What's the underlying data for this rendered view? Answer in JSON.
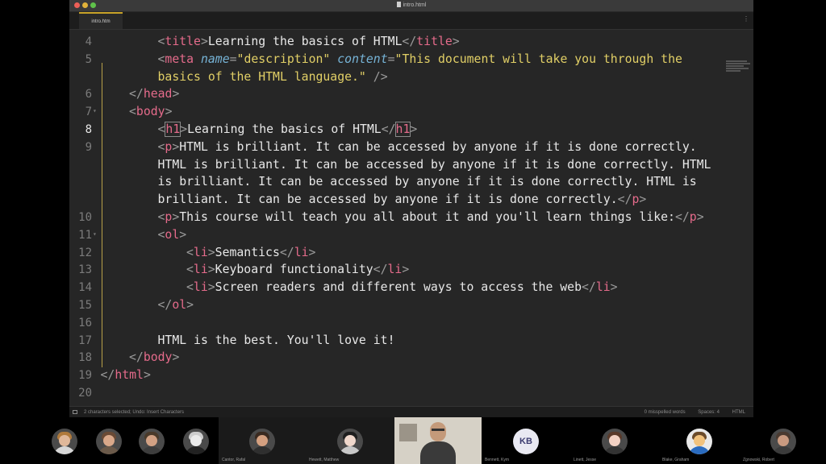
{
  "window": {
    "title": "intro.html",
    "tab_label": "intro.htm",
    "tab_menu_icon": "more-vertical-icon"
  },
  "editor": {
    "lines": [
      {
        "n": "4",
        "indent": 2,
        "parts": [
          [
            "punct",
            "<"
          ],
          [
            "tag",
            "title"
          ],
          [
            "punct",
            ">"
          ],
          [
            "txt",
            "Learning the basics of HTML"
          ],
          [
            "punct",
            "</"
          ],
          [
            "tag",
            "title"
          ],
          [
            "punct",
            ">"
          ]
        ]
      },
      {
        "n": "5",
        "indent": 2,
        "parts": [
          [
            "punct",
            "<"
          ],
          [
            "tag",
            "meta "
          ],
          [
            "attr",
            "name"
          ],
          [
            "punct",
            "="
          ],
          [
            "str",
            "\"description\""
          ],
          [
            "txt",
            " "
          ],
          [
            "attr",
            "content"
          ],
          [
            "punct",
            "="
          ],
          [
            "str",
            "\"This document will take you through the"
          ]
        ]
      },
      {
        "n": "",
        "indent": 2,
        "parts": [
          [
            "str",
            "basics of the HTML language.\""
          ],
          [
            "txt",
            " "
          ],
          [
            "punct",
            "/>"
          ]
        ]
      },
      {
        "n": "6",
        "indent": 1,
        "parts": [
          [
            "punct",
            "</"
          ],
          [
            "tag",
            "head"
          ],
          [
            "punct",
            ">"
          ]
        ]
      },
      {
        "n": "7",
        "indent": 1,
        "fold": true,
        "parts": [
          [
            "punct",
            "<"
          ],
          [
            "tag",
            "body"
          ],
          [
            "punct",
            ">"
          ]
        ]
      },
      {
        "n": "8",
        "indent": 2,
        "active": true,
        "parts": [
          [
            "punct",
            "<"
          ],
          [
            "cursor",
            ""
          ],
          [
            "tag",
            "h1"
          ],
          [
            "punct",
            ">"
          ],
          [
            "txt",
            "Learning the basics of HTML"
          ],
          [
            "punct",
            "</"
          ],
          [
            "tag",
            "h1"
          ],
          [
            "punct",
            ">"
          ]
        ]
      },
      {
        "n": "9",
        "indent": 2,
        "parts": [
          [
            "punct",
            "<"
          ],
          [
            "tag",
            "p"
          ],
          [
            "punct",
            ">"
          ],
          [
            "txt",
            "HTML is brilliant. It can be accessed by anyone if it is done correctly."
          ]
        ]
      },
      {
        "n": "",
        "indent": 2,
        "parts": [
          [
            "txt",
            "HTML is brilliant. It can be accessed by anyone if it is done correctly. HTML"
          ]
        ]
      },
      {
        "n": "",
        "indent": 2,
        "parts": [
          [
            "txt",
            "is brilliant. It can be accessed by anyone if it is done correctly. HTML is"
          ]
        ]
      },
      {
        "n": "",
        "indent": 2,
        "parts": [
          [
            "txt",
            "brilliant. It can be accessed by anyone if it is done correctly."
          ],
          [
            "punct",
            "</"
          ],
          [
            "tag",
            "p"
          ],
          [
            "punct",
            ">"
          ]
        ]
      },
      {
        "n": "10",
        "indent": 2,
        "parts": [
          [
            "punct",
            "<"
          ],
          [
            "tag",
            "p"
          ],
          [
            "punct",
            ">"
          ],
          [
            "txt",
            "This course will teach you all about it and you'll learn things like:"
          ],
          [
            "punct",
            "</"
          ],
          [
            "tag",
            "p"
          ],
          [
            "punct",
            ">"
          ]
        ]
      },
      {
        "n": "11",
        "indent": 2,
        "fold": true,
        "parts": [
          [
            "punct",
            "<"
          ],
          [
            "tag",
            "ol"
          ],
          [
            "punct",
            ">"
          ]
        ]
      },
      {
        "n": "12",
        "indent": 3,
        "parts": [
          [
            "punct",
            "<"
          ],
          [
            "tag",
            "li"
          ],
          [
            "punct",
            ">"
          ],
          [
            "txt",
            "Semantics"
          ],
          [
            "punct",
            "</"
          ],
          [
            "tag",
            "li"
          ],
          [
            "punct",
            ">"
          ]
        ]
      },
      {
        "n": "13",
        "indent": 3,
        "parts": [
          [
            "punct",
            "<"
          ],
          [
            "tag",
            "li"
          ],
          [
            "punct",
            ">"
          ],
          [
            "txt",
            "Keyboard functionality"
          ],
          [
            "punct",
            "</"
          ],
          [
            "tag",
            "li"
          ],
          [
            "punct",
            ">"
          ]
        ]
      },
      {
        "n": "14",
        "indent": 3,
        "parts": [
          [
            "punct",
            "<"
          ],
          [
            "tag",
            "li"
          ],
          [
            "punct",
            ">"
          ],
          [
            "txt",
            "Screen readers and different ways to access the web"
          ],
          [
            "punct",
            "</"
          ],
          [
            "tag",
            "li"
          ],
          [
            "punct",
            ">"
          ]
        ]
      },
      {
        "n": "15",
        "indent": 2,
        "parts": [
          [
            "punct",
            "</"
          ],
          [
            "tag",
            "ol"
          ],
          [
            "punct",
            ">"
          ]
        ]
      },
      {
        "n": "16",
        "indent": 2,
        "parts": []
      },
      {
        "n": "17",
        "indent": 2,
        "parts": [
          [
            "txt",
            "HTML is the best. You'll love it!"
          ]
        ]
      },
      {
        "n": "18",
        "indent": 1,
        "parts": [
          [
            "punct",
            "</"
          ],
          [
            "tag",
            "body"
          ],
          [
            "punct",
            ">"
          ]
        ]
      },
      {
        "n": "19",
        "indent": 0,
        "parts": [
          [
            "punct",
            "</"
          ],
          [
            "tag",
            "html"
          ],
          [
            "punct",
            ">"
          ]
        ]
      },
      {
        "n": "20",
        "indent": 0,
        "parts": []
      }
    ]
  },
  "status": {
    "left": "2 characters selected; Undo: Insert Characters",
    "misspelled": "0 misspelled words",
    "spaces": "Spaces: 4",
    "syntax": "HTML"
  },
  "participants": [
    {
      "name": ""
    },
    {
      "name": ""
    },
    {
      "name": ""
    },
    {
      "name": ""
    },
    {
      "name": "Cantor, Rafal"
    },
    {
      "name": "Hewett, Matthew"
    },
    {
      "name": ""
    },
    {
      "name": "Bennett, Kym",
      "initials": "KB"
    },
    {
      "name": "Linett, Jesse"
    },
    {
      "name": "Blake, Graham"
    },
    {
      "name": "Zgnowski, Robert"
    }
  ],
  "colors": {
    "tag": "#e56b8b",
    "attribute": "#76b3d6",
    "string": "#e1cf66",
    "text": "#e8e8e8",
    "tab_accent": "#c7a227"
  }
}
